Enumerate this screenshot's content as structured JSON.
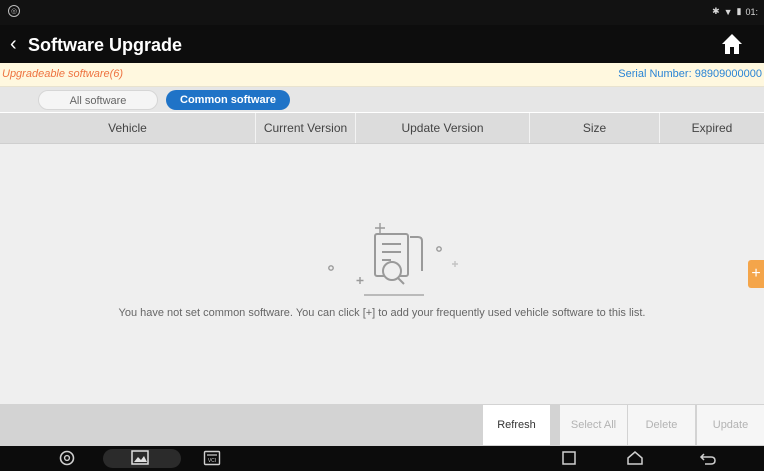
{
  "window": {
    "title": "Software Upgrade"
  },
  "status_bar": {
    "right_text": "01:"
  },
  "info": {
    "upgradeable": "Upgradeable software(6)",
    "serial": "Serial Number: 98909000000"
  },
  "tabs": [
    {
      "label": "All software",
      "active": false
    },
    {
      "label": "Common software",
      "active": true
    }
  ],
  "table": {
    "columns": [
      "Vehicle",
      "Current Version",
      "Update Version",
      "Size",
      "Expired"
    ]
  },
  "empty_state": {
    "message": "You have not set common software. You can click [+] to add your frequently used vehicle software to this list."
  },
  "fab": {
    "label": "+"
  },
  "actions": {
    "refresh": "Refresh",
    "select_all": "Select All",
    "delete": "Delete",
    "update": "Update"
  },
  "colors": {
    "accent": "#1f73c7",
    "warning_text": "#ee7340",
    "serial_text": "#2a84d5",
    "fab": "#f4a54a"
  },
  "icons": {
    "back": "chevron-left-icon",
    "home": "home-icon",
    "empty": "document-search-icon",
    "nav_browser": "browser-icon",
    "nav_gallery": "gallery-icon",
    "nav_vci": "vci-icon",
    "nav_recent": "recent-apps-icon",
    "nav_home": "home-nav-icon",
    "nav_back": "back-nav-icon"
  }
}
